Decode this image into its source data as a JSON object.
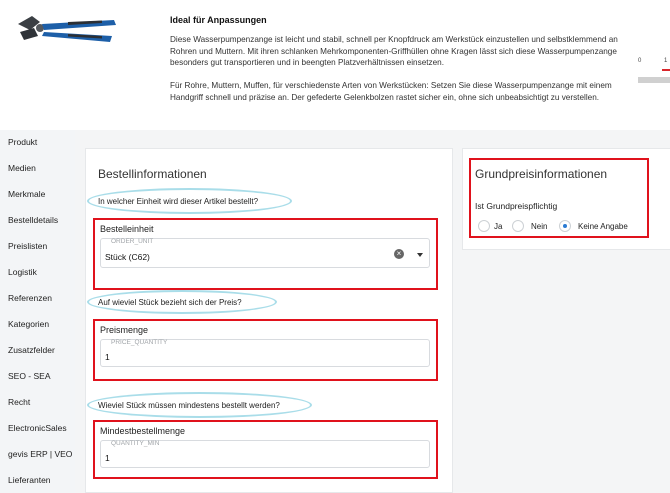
{
  "product": {
    "image_icon": "water-pump-pliers-image",
    "title": "Ideal für Anpassungen",
    "description_1": "Diese Wasserpumpenzange ist leicht und stabil, schnell per Knopfdruck am Werkstück einzustellen und selbstklemmend an Rohren und Muttern. Mit ihren schlanken Mehrkomponenten-Griffhüllen ohne Kragen lässt sich diese Wasserpumpenzange besonders gut transportieren und in beengten Platzverhältnissen einsetzen.",
    "description_2": "Für Rohre, Muttern, Muffen, für verschiedenste Arten von Werkstücken: Setzen Sie diese Wasserpumpenzange mit einem Handgriff schnell und präzise an. Der gefederte Gelenkbolzen rastet sicher ein, ohne sich unbeabsichtigt zu verstellen.",
    "scale_min": "0",
    "scale_max": "1"
  },
  "sidebar": {
    "items": [
      {
        "label": "Produkt"
      },
      {
        "label": "Medien"
      },
      {
        "label": "Merkmale"
      },
      {
        "label": "Bestelldetails"
      },
      {
        "label": "Preislisten"
      },
      {
        "label": "Logistik"
      },
      {
        "label": "Referenzen"
      },
      {
        "label": "Kategorien"
      },
      {
        "label": "Zusatzfelder"
      },
      {
        "label": "SEO - SEA"
      },
      {
        "label": "Recht"
      },
      {
        "label": "ElectronicSales"
      },
      {
        "label": "gevis ERP | VEO"
      },
      {
        "label": "Lieferanten"
      }
    ]
  },
  "order_info": {
    "title": "Bestellinformationen",
    "question_unit": "In welcher Einheit wird dieser Artikel bestellt?",
    "unit_label": "Bestelleinheit",
    "unit_legend": "ORDER_UNIT",
    "unit_value": "Stück (C62)",
    "question_price": "Auf wieviel Stück bezieht sich der Preis?",
    "price_qty_label": "Preismenge",
    "price_qty_legend": "PRICE_QUANTITY",
    "price_qty_value": "1",
    "question_min": "Wieviel Stück müssen mindestens bestellt werden?",
    "min_qty_label": "Mindestbestellmenge",
    "min_qty_legend": "QUANTITY_MIN",
    "min_qty_value": "1"
  },
  "base_price": {
    "title": "Grundpreisinformationen",
    "question": "Ist Grundpreispflichtig",
    "options": [
      {
        "label": "Ja",
        "checked": false
      },
      {
        "label": "Nein",
        "checked": false
      },
      {
        "label": "Keine Angabe",
        "checked": true
      }
    ]
  },
  "colors": {
    "annotation_red": "#e0121c",
    "annotation_cyan": "#a9dde9",
    "radio_accent": "#2a7bd3"
  }
}
